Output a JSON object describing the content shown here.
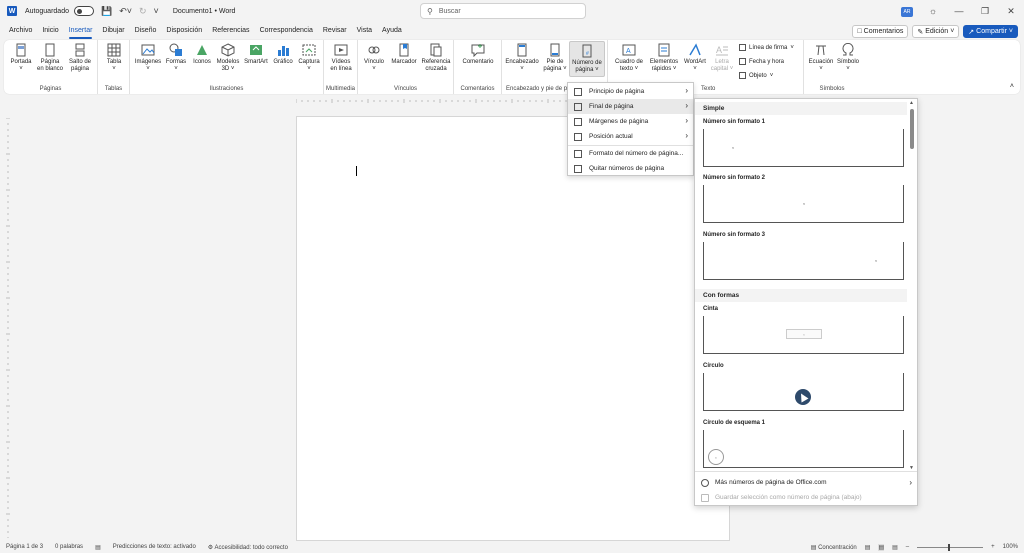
{
  "titlebar": {
    "autosave_label": "Autoguardado",
    "doc_title": "Documento1 • Word",
    "search_placeholder": "Buscar",
    "user_initials": "AR"
  },
  "tabs": [
    "Archivo",
    "Inicio",
    "Insertar",
    "Dibujar",
    "Diseño",
    "Disposición",
    "Referencias",
    "Correspondencia",
    "Revisar",
    "Vista",
    "Ayuda"
  ],
  "active_tab": "Insertar",
  "actions": {
    "comments": "Comentarios",
    "edit": "Edición",
    "share": "Compartir"
  },
  "ribbon": {
    "groups": {
      "paginas": "Páginas",
      "tablas": "Tablas",
      "ilustraciones": "Ilustraciones",
      "multimedia": "Multimedia",
      "vinculos": "Vínculos",
      "comentarios": "Comentarios",
      "encabezado": "Encabezado y pie de página",
      "texto": "Texto",
      "simbolos": "Símbolos"
    },
    "buttons": {
      "portada": "Portada",
      "pagina_blanco_1": "Página",
      "pagina_blanco_2": "en blanco",
      "salto_1": "Salto de",
      "salto_2": "página",
      "tabla": "Tabla",
      "imagenes": "Imágenes",
      "formas": "Formas",
      "iconos": "Iconos",
      "modelos_1": "Modelos",
      "modelos_2": "3D",
      "smartart": "SmartArt",
      "grafico": "Gráfico",
      "captura": "Captura",
      "videos_1": "Vídeos",
      "videos_2": "en línea",
      "vinculo": "Vínculo",
      "marcador": "Marcador",
      "referencia_1": "Referencia",
      "referencia_2": "cruzada",
      "comentario": "Comentario",
      "encabezado": "Encabezado",
      "pie_1": "Pie de",
      "pie_2": "página",
      "numero_1": "Número de",
      "numero_2": "página",
      "cuadro_1": "Cuadro de",
      "cuadro_2": "texto",
      "elementos_1": "Elementos",
      "elementos_2": "rápidos",
      "wordart": "WordArt",
      "letra_1": "Letra",
      "letra_2": "capital",
      "linea_firma": "Línea de firma",
      "fecha_hora": "Fecha y hora",
      "objeto": "Objeto",
      "ecuacion": "Ecuación",
      "simbolo": "Símbolo"
    }
  },
  "dropdown": {
    "items": [
      {
        "label": "Principio de página",
        "submenu": true
      },
      {
        "label": "Final de página",
        "submenu": true
      },
      {
        "label": "Márgenes de página",
        "submenu": true
      },
      {
        "label": "Posición actual",
        "submenu": true
      },
      {
        "label": "Formato del número de página...",
        "submenu": false
      },
      {
        "label": "Quitar números de página",
        "submenu": false
      }
    ]
  },
  "gallery": {
    "section_simple": "Simple",
    "section_shapes": "Con formas",
    "items": [
      {
        "title": "Número sin formato 1"
      },
      {
        "title": "Número sin formato 2"
      },
      {
        "title": "Número sin formato 3"
      },
      {
        "title": "Cinta"
      },
      {
        "title": "Círculo"
      },
      {
        "title": "Círculo de esquema 1"
      }
    ],
    "footer": {
      "more": "Más números de página de Office.com",
      "save": "Guardar selección como número de página (abajo)"
    }
  },
  "statusbar": {
    "page": "Página 1 de 3",
    "words": "0 palabras",
    "predictions": "Predicciones de texto: activado",
    "accessibility": "Accesibilidad: todo correcto",
    "focus": "Concentración",
    "zoom": "100%"
  },
  "colors": {
    "accent": "#185abd",
    "circle_fill": "#2e4a6b"
  }
}
